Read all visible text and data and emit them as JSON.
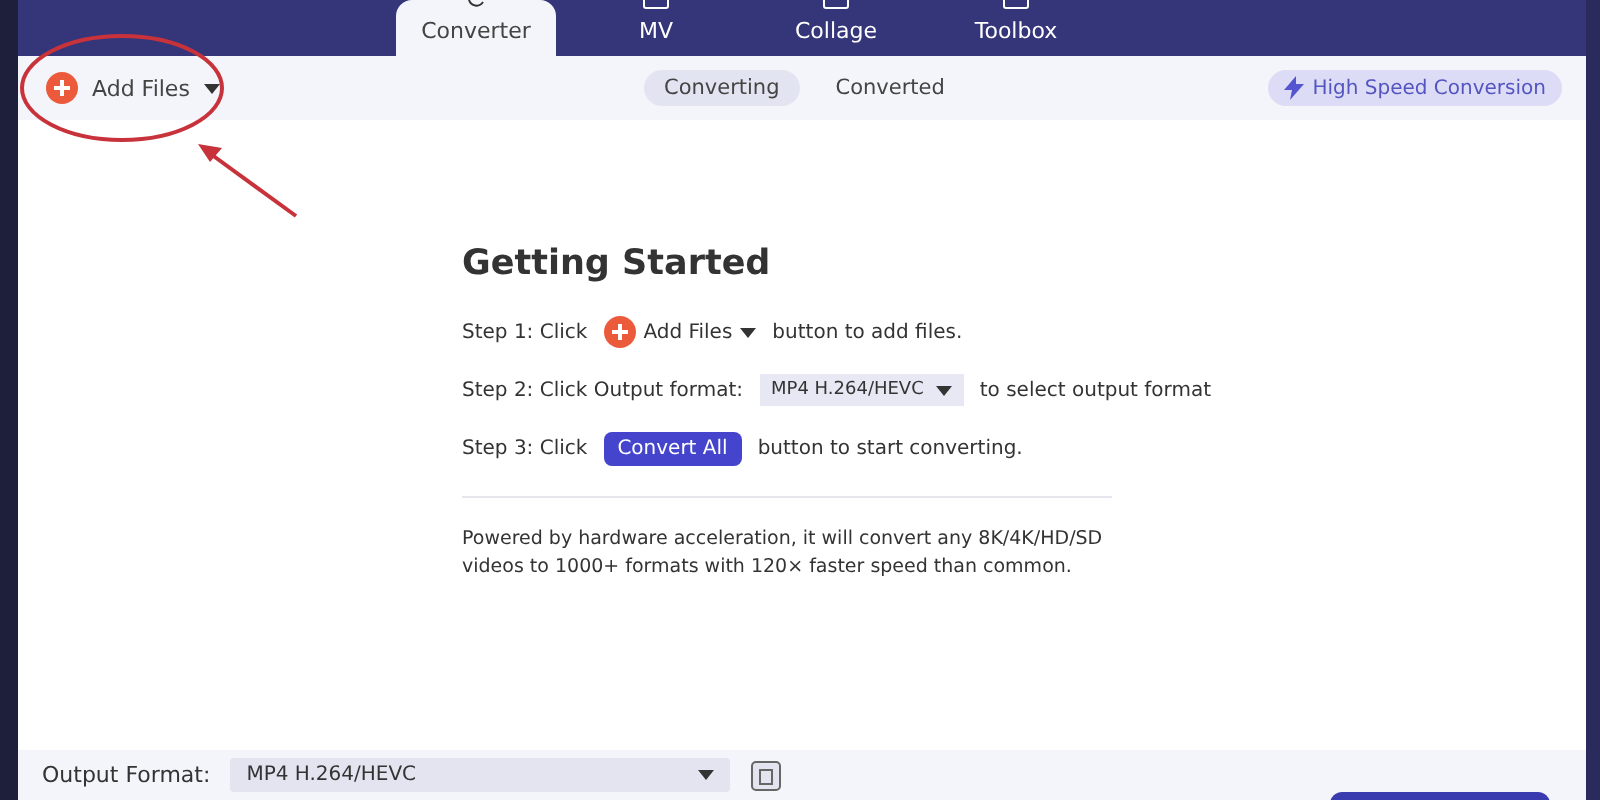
{
  "tabs": [
    {
      "label": "Converter",
      "selected": true
    },
    {
      "label": "MV",
      "selected": false
    },
    {
      "label": "Collage",
      "selected": false
    },
    {
      "label": "Toolbox",
      "selected": false
    }
  ],
  "add_files": {
    "label": "Add Files"
  },
  "subtabs": [
    {
      "label": "Converting",
      "selected": true
    },
    {
      "label": "Converted",
      "selected": false
    }
  ],
  "high_speed": {
    "label": "High Speed Conversion"
  },
  "guide": {
    "title": "Getting Started",
    "steps": [
      {
        "kind": "add",
        "prefix": "Step 1: Click",
        "control": "Add Files",
        "suffix": "button to add files."
      },
      {
        "kind": "format",
        "prefix": "Step 2: Click Output format:",
        "control": "MP4 H.264/HEVC",
        "suffix": "to select output format"
      },
      {
        "kind": "button",
        "prefix": "Step 3: Click",
        "control": "Convert All",
        "suffix": "button to start converting."
      }
    ],
    "note": "Powered by hardware acceleration, it will convert any 8K/4K/HD/SD videos to 1000+ formats with 120× faster speed than common."
  },
  "bottom": {
    "output_label": "Output Format:",
    "format": "MP4 H.264/HEVC"
  }
}
